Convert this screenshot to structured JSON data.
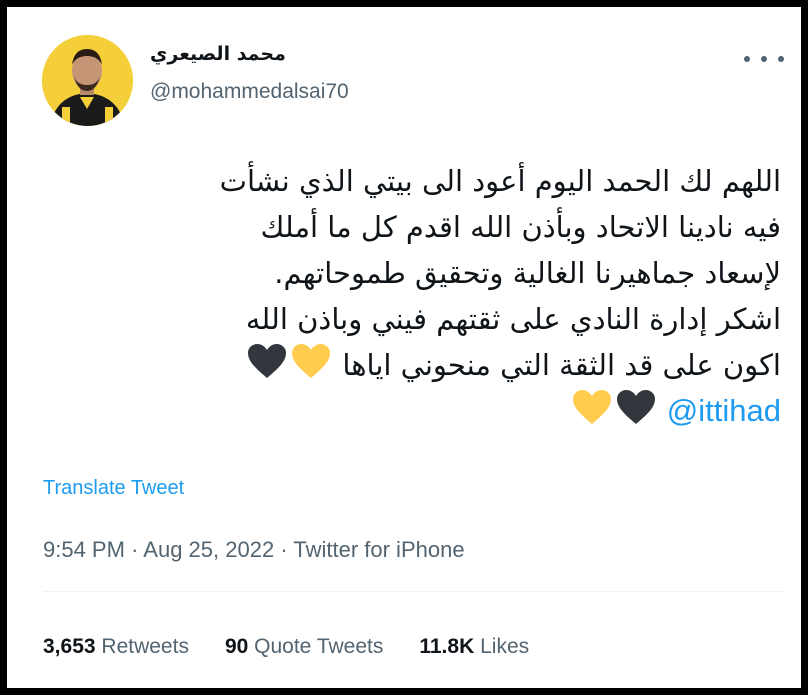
{
  "author": {
    "name": "محمد الصيعري",
    "handle": "@mohammedalsai70"
  },
  "tweet": {
    "lines": [
      "اللهم لك الحمد اليوم أعود الى بيتي الذي نشأت",
      "فيه نادينا الاتحاد وبأذن الله اقدم كل ما أملك",
      "لإسعاد جماهيرنا الغالية وتحقيق طموحاتهم.",
      "اشكر إدارة النادي على ثقتهم فيني وباذن الله",
      "اكون على قد الثقة التي منحوني اياها"
    ],
    "mention": "@ittihad"
  },
  "icons": {
    "heart_yellow": "yellow-heart-icon",
    "heart_black": "black-heart-icon",
    "more": "more-icon"
  },
  "colors": {
    "accent": "#1d9bf0",
    "text": "#0f1419",
    "secondary": "#536471",
    "heart_yellow": "#FFCC4D",
    "heart_black": "#31373D"
  },
  "translate_label": "Translate Tweet",
  "meta": {
    "time": "9:54 PM",
    "date": "Aug 25, 2022",
    "source": "Twitter for iPhone",
    "separator": "·"
  },
  "stats": {
    "retweets_count": "3,653",
    "retweets_label": "Retweets",
    "quotes_count": "90",
    "quotes_label": "Quote Tweets",
    "likes_count": "11.8K",
    "likes_label": "Likes"
  }
}
